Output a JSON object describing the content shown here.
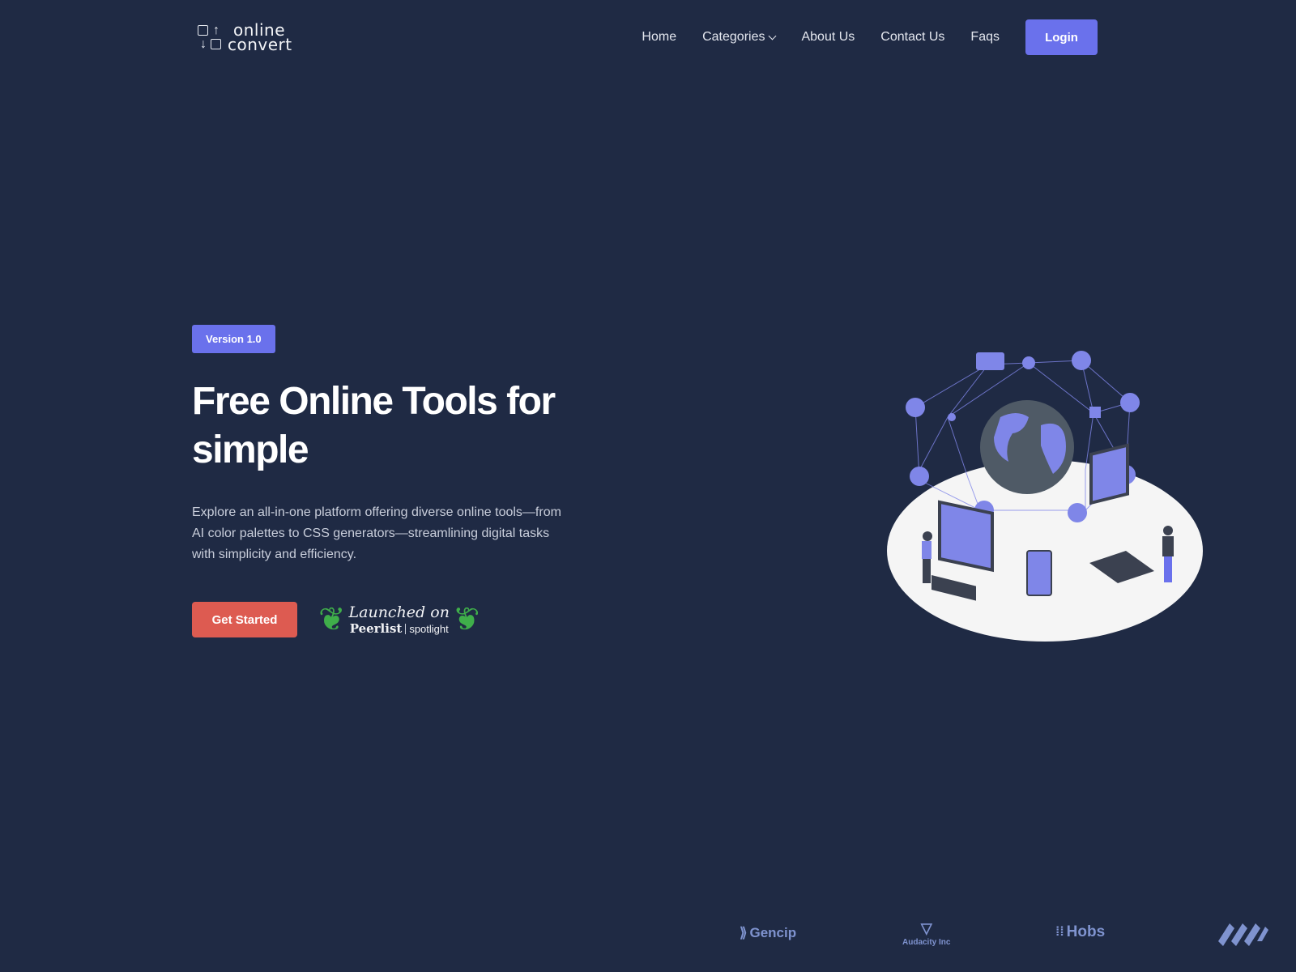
{
  "logo": {
    "line1": "online",
    "line2": "convert",
    "glyph_up": "↑",
    "glyph_down": "↓"
  },
  "nav": {
    "items": [
      {
        "label": "Home"
      },
      {
        "label": "Categories",
        "has_dropdown": true
      },
      {
        "label": "About Us"
      },
      {
        "label": "Contact Us"
      },
      {
        "label": "Faqs"
      }
    ],
    "login_label": "Login"
  },
  "hero": {
    "badge": "Version 1.0",
    "title": "Free Online Tools for simple",
    "description": "Explore an all-in-one platform offering diverse online tools—from AI color palettes to CSS generators—streamlining digital tasks with simplicity and efficiency.",
    "cta_label": "Get Started",
    "peerlist": {
      "launched": "Launched on",
      "brand": "Peerlist",
      "tag": "spotlight"
    }
  },
  "illustration": {
    "alt": "Global network illustration with people using devices around a globe"
  },
  "partners": [
    {
      "name": "Gencip"
    },
    {
      "name": "Audacity Inc"
    },
    {
      "name": "Hobs"
    },
    {
      "name": ""
    }
  ],
  "colors": {
    "background": "#1f2a44",
    "accent": "#6a71ec",
    "cta": "#dd5b51",
    "partner": "#7f93cf"
  }
}
